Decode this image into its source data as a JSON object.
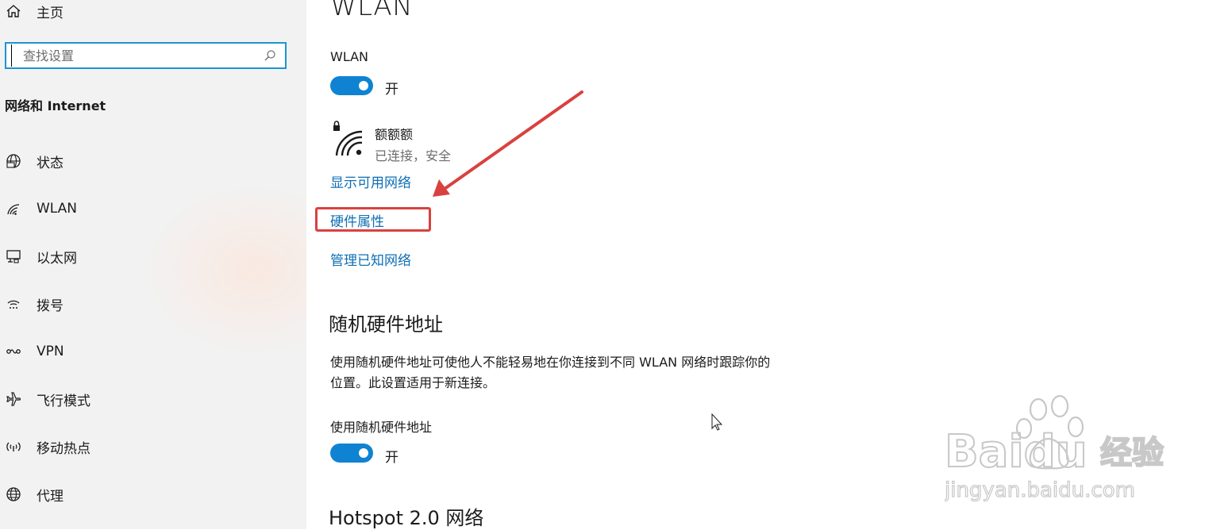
{
  "sidebar": {
    "home_label": "主页",
    "search_placeholder": "查找设置",
    "section_title": "网络和 Internet",
    "items": [
      {
        "label": "状态",
        "icon": "globe-icon"
      },
      {
        "label": "WLAN",
        "icon": "wifi-icon"
      },
      {
        "label": "以太网",
        "icon": "ethernet-icon"
      },
      {
        "label": "拨号",
        "icon": "dialup-icon"
      },
      {
        "label": "VPN",
        "icon": "vpn-icon"
      },
      {
        "label": "飞行模式",
        "icon": "airplane-icon"
      },
      {
        "label": "移动热点",
        "icon": "hotspot-icon"
      },
      {
        "label": "代理",
        "icon": "proxy-globe-icon"
      }
    ]
  },
  "main": {
    "title": "WLAN",
    "wlan_label": "WLAN",
    "wlan_toggle_state": "开",
    "network": {
      "name": "额额额",
      "status": "已连接，安全"
    },
    "links": {
      "show_networks": "显示可用网络",
      "hardware_properties": "硬件属性",
      "manage_known": "管理已知网络"
    },
    "random_hw": {
      "heading": "随机硬件地址",
      "description": "使用随机硬件地址可使他人不能轻易地在你连接到不同 WLAN 网络时跟踪你的位置。此设置适用于新连接。",
      "toggle_label": "使用随机硬件地址",
      "toggle_state": "开"
    },
    "hotspot_heading": "Hotspot 2.0 网络"
  },
  "watermark": {
    "brand": "Baidu",
    "brand_cn": "经验",
    "url": "jingyan.baidu.com"
  },
  "colors": {
    "accent": "#0f83d1",
    "link": "#0f6fb5",
    "annotation": "#d9413f",
    "sidebar_bg": "#f2f2f2"
  }
}
